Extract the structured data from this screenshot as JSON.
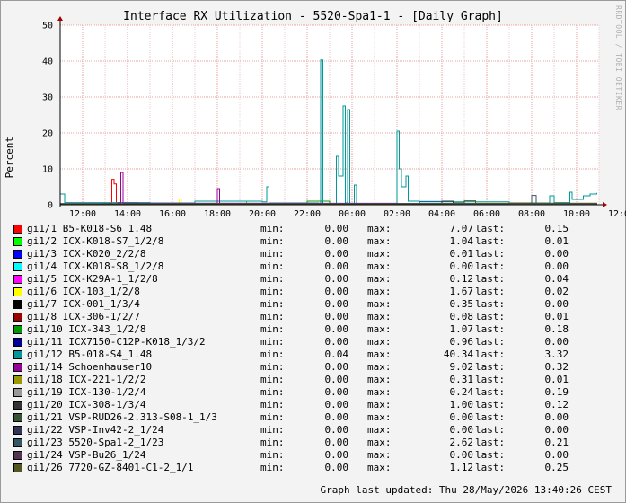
{
  "page": {
    "title": "Interface RX Utilization - 5520-Spa1-1 - [Daily Graph]",
    "watermark": "RRDTOOL / TOBI OETIKER",
    "updated": "Graph last updated: Thu 28/May/2026 13:40:26 CEST"
  },
  "legend_labels": {
    "min": "min:",
    "max": "max:",
    "last": "last:"
  },
  "chart_data": {
    "type": "line",
    "title": "Interface RX Utilization - 5520-Spa1-1 - [Daily Graph]",
    "ylabel": "Percent",
    "xlabel": "",
    "ylim": [
      0,
      50
    ],
    "yticks": [
      0,
      10,
      20,
      30,
      40,
      50
    ],
    "xticks": [
      "12:00",
      "14:00",
      "16:00",
      "18:00",
      "20:00",
      "22:00",
      "00:00",
      "02:00",
      "04:00",
      "06:00",
      "08:00",
      "10:00",
      "12:00"
    ],
    "grid": true,
    "legend_placement": "bottom",
    "series": [
      {
        "name": "gi1/1 B5-K018-S6_1.48",
        "color": "#ff0000",
        "min": "0.00",
        "max": "7.07",
        "last": "0.15",
        "points": [
          [
            1.8,
            0.3
          ],
          [
            2.2,
            0.5
          ],
          [
            2.3,
            7.1
          ],
          [
            2.4,
            5.8
          ],
          [
            2.5,
            0.6
          ],
          [
            3.5,
            0.4
          ],
          [
            6.0,
            0.2
          ],
          [
            10.0,
            0.2
          ],
          [
            15.0,
            0.2
          ],
          [
            20.0,
            0.3
          ],
          [
            23.9,
            0.15
          ]
        ]
      },
      {
        "name": "gi1/2 ICX-K018-S7_1/2/8",
        "color": "#00ff00",
        "min": "0.00",
        "max": "1.04",
        "last": "0.01",
        "points": [
          [
            0,
            0.1
          ],
          [
            4.0,
            0.2
          ],
          [
            8.0,
            0.3
          ],
          [
            8.3,
            1.0
          ],
          [
            8.5,
            0.2
          ],
          [
            14.0,
            0.1
          ],
          [
            23.9,
            0.01
          ]
        ]
      },
      {
        "name": "gi1/3 ICX-K020_2/2/8",
        "color": "#0000ff",
        "min": "0.00",
        "max": "0.01",
        "last": "0.00",
        "points": [
          [
            0,
            0.01
          ],
          [
            12.0,
            0.01
          ],
          [
            23.9,
            0.0
          ]
        ]
      },
      {
        "name": "gi1/4 ICX-K018-S8_1/2/8",
        "color": "#00ffff",
        "min": "0.00",
        "max": "0.00",
        "last": "0.00",
        "points": [
          [
            0,
            0.0
          ],
          [
            23.9,
            0.0
          ]
        ]
      },
      {
        "name": "gi1/5 ICX-K29A-1_1/2/8",
        "color": "#ff00ff",
        "min": "0.00",
        "max": "0.12",
        "last": "0.04",
        "points": [
          [
            0,
            0.05
          ],
          [
            12.0,
            0.1
          ],
          [
            23.9,
            0.04
          ]
        ]
      },
      {
        "name": "gi1/6 ICX-103_1/2/8",
        "color": "#ffff00",
        "min": "0.00",
        "max": "1.67",
        "last": "0.02",
        "points": [
          [
            0,
            0.1
          ],
          [
            5.2,
            0.2
          ],
          [
            5.3,
            1.6
          ],
          [
            5.4,
            0.2
          ],
          [
            12.0,
            0.1
          ],
          [
            23.9,
            0.02
          ]
        ]
      },
      {
        "name": "gi1/7 ICX-001_1/3/4",
        "color": "#000000",
        "min": "0.00",
        "max": "0.35",
        "last": "0.00",
        "points": [
          [
            0,
            0.1
          ],
          [
            10.0,
            0.3
          ],
          [
            23.9,
            0.0
          ]
        ]
      },
      {
        "name": "gi1/8 ICX-306-1/2/7",
        "color": "#990000",
        "min": "0.00",
        "max": "0.08",
        "last": "0.01",
        "points": [
          [
            0,
            0.05
          ],
          [
            23.9,
            0.01
          ]
        ]
      },
      {
        "name": "gi1/10 ICX-343_1/2/8",
        "color": "#009900",
        "min": "0.00",
        "max": "1.07",
        "last": "0.18",
        "points": [
          [
            0,
            0.2
          ],
          [
            6.0,
            0.4
          ],
          [
            11.0,
            1.0
          ],
          [
            12.0,
            0.3
          ],
          [
            23.9,
            0.18
          ]
        ]
      },
      {
        "name": "gi1/11 ICX7150-C12P-K018_1/3/2",
        "color": "#000099",
        "min": "0.00",
        "max": "0.96",
        "last": "0.00",
        "points": [
          [
            0,
            0.1
          ],
          [
            16.0,
            0.9
          ],
          [
            17.0,
            0.2
          ],
          [
            23.9,
            0.0
          ]
        ]
      },
      {
        "name": "gi1/12 B5-018-S4_1.48",
        "color": "#009999",
        "min": "0.04",
        "max": "40.34",
        "last": "3.32",
        "points": [
          [
            0.0,
            3.0
          ],
          [
            0.1,
            3.0
          ],
          [
            0.2,
            0.6
          ],
          [
            4.0,
            0.5
          ],
          [
            6.0,
            1.0
          ],
          [
            9.0,
            0.8
          ],
          [
            9.2,
            5.0
          ],
          [
            9.3,
            0.5
          ],
          [
            11.5,
            0.4
          ],
          [
            11.6,
            40.3
          ],
          [
            11.7,
            0.3
          ],
          [
            12.2,
            0.3
          ],
          [
            12.3,
            13.5
          ],
          [
            12.4,
            8.0
          ],
          [
            12.6,
            27.5
          ],
          [
            12.7,
            0.5
          ],
          [
            12.8,
            26.5
          ],
          [
            12.9,
            0.4
          ],
          [
            13.1,
            5.5
          ],
          [
            13.2,
            0.3
          ],
          [
            14.9,
            0.3
          ],
          [
            15.0,
            20.5
          ],
          [
            15.1,
            10.0
          ],
          [
            15.2,
            5.0
          ],
          [
            15.4,
            8.0
          ],
          [
            15.5,
            1.0
          ],
          [
            16.0,
            0.8
          ],
          [
            20.0,
            0.5
          ],
          [
            21.8,
            2.5
          ],
          [
            22.0,
            0.6
          ],
          [
            22.7,
            3.5
          ],
          [
            22.8,
            1.5
          ],
          [
            23.3,
            2.5
          ],
          [
            23.6,
            3.0
          ],
          [
            23.9,
            3.32
          ]
        ]
      },
      {
        "name": "gi1/14 Schoenhauser10",
        "color": "#990099",
        "min": "0.00",
        "max": "9.02",
        "last": "0.32",
        "points": [
          [
            0,
            0.3
          ],
          [
            2.6,
            0.5
          ],
          [
            2.7,
            9.0
          ],
          [
            2.8,
            0.4
          ],
          [
            6.9,
            0.4
          ],
          [
            7.0,
            4.5
          ],
          [
            7.1,
            0.4
          ],
          [
            15.0,
            0.3
          ],
          [
            23.9,
            0.32
          ]
        ]
      },
      {
        "name": "gi1/18 ICX-221-1/2/2",
        "color": "#999900",
        "min": "0.00",
        "max": "0.31",
        "last": "0.01",
        "points": [
          [
            0,
            0.1
          ],
          [
            18.0,
            0.3
          ],
          [
            23.9,
            0.01
          ]
        ]
      },
      {
        "name": "gi1/19 ICX-130-1/2/4",
        "color": "#999999",
        "min": "0.00",
        "max": "0.24",
        "last": "0.19",
        "points": [
          [
            0,
            0.1
          ],
          [
            12.0,
            0.2
          ],
          [
            23.9,
            0.19
          ]
        ]
      },
      {
        "name": "gi1/20 ICX-308-1/3/4",
        "color": "#333333",
        "min": "0.00",
        "max": "1.00",
        "last": "0.12",
        "points": [
          [
            0,
            0.2
          ],
          [
            17.0,
            1.0
          ],
          [
            17.5,
            0.3
          ],
          [
            23.9,
            0.12
          ]
        ]
      },
      {
        "name": "gi1/21 VSP-RUD26-2.313-S08-1_1/3",
        "color": "#335533",
        "min": "0.00",
        "max": "0.00",
        "last": "0.00",
        "points": [
          [
            0,
            0.0
          ],
          [
            23.9,
            0.0
          ]
        ]
      },
      {
        "name": "gi1/22 VSP-Inv42-2_1/24",
        "color": "#333355",
        "min": "0.00",
        "max": "0.00",
        "last": "0.00",
        "points": [
          [
            0,
            0.0
          ],
          [
            23.9,
            0.0
          ]
        ]
      },
      {
        "name": "gi1/23 5520-Spa1-2_1/23",
        "color": "#335566",
        "min": "0.00",
        "max": "2.62",
        "last": "0.21",
        "points": [
          [
            0,
            0.3
          ],
          [
            20.0,
            0.5
          ],
          [
            21.0,
            2.6
          ],
          [
            21.2,
            0.4
          ],
          [
            23.9,
            0.21
          ]
        ]
      },
      {
        "name": "gi1/24 VSP-Bu26_1/24",
        "color": "#553355",
        "min": "0.00",
        "max": "0.00",
        "last": "0.00",
        "points": [
          [
            0,
            0.0
          ],
          [
            23.9,
            0.0
          ]
        ]
      },
      {
        "name": "gi1/26 7720-GZ-8401-C1-2_1/1",
        "color": "#555522",
        "min": "0.00",
        "max": "1.12",
        "last": "0.25",
        "points": [
          [
            0,
            0.2
          ],
          [
            17.5,
            0.5
          ],
          [
            18.0,
            1.1
          ],
          [
            18.5,
            0.4
          ],
          [
            23.9,
            0.25
          ]
        ]
      }
    ]
  }
}
